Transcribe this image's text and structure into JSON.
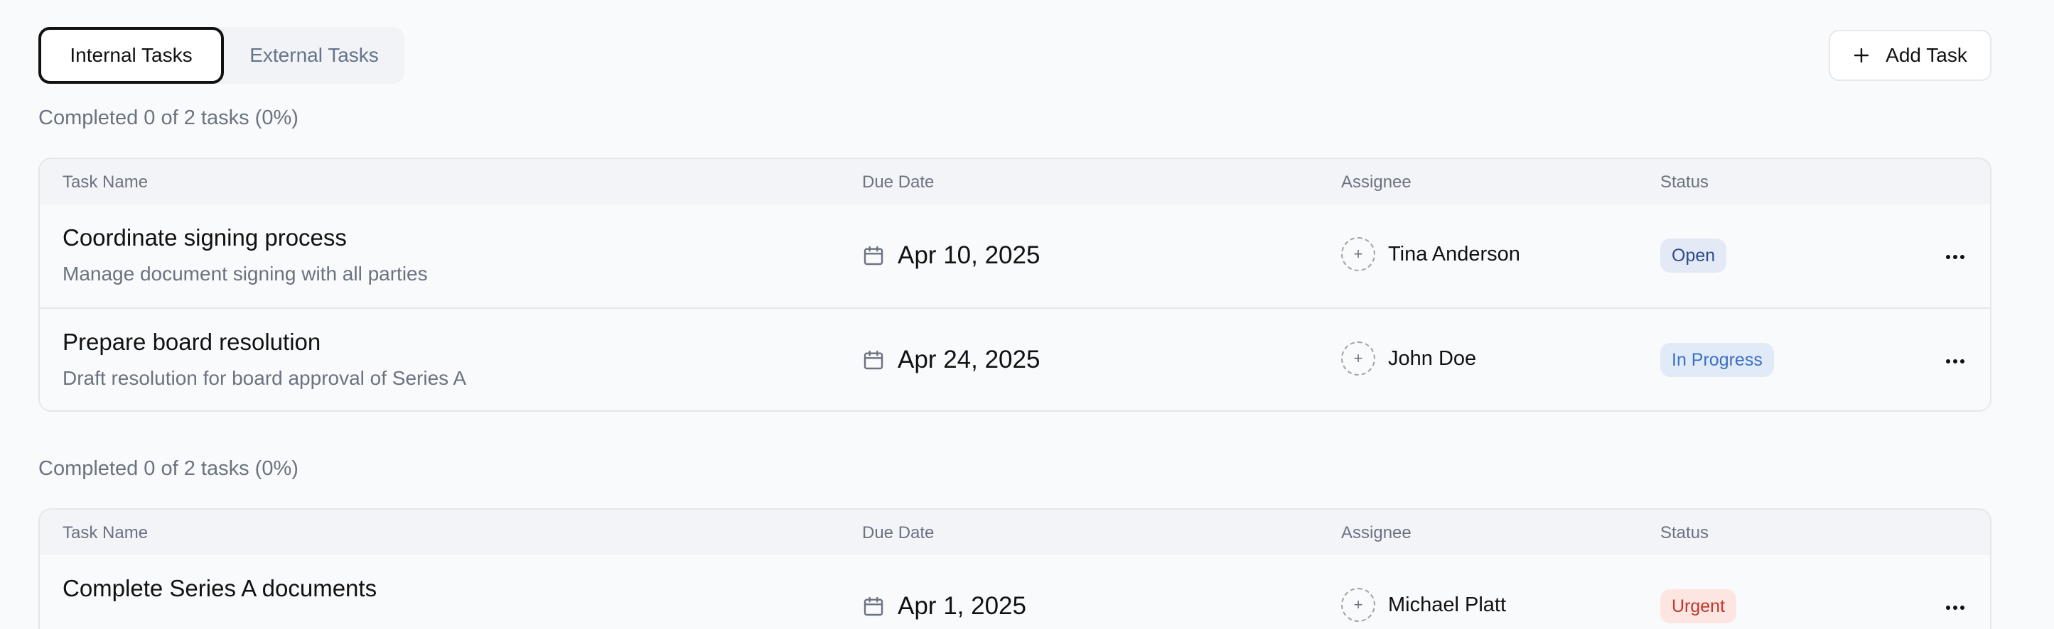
{
  "tabs": [
    {
      "label": "Internal Tasks",
      "active": true
    },
    {
      "label": "External Tasks",
      "active": false
    }
  ],
  "add_task_label": "Add Task",
  "columns": {
    "name": "Task Name",
    "due": "Due Date",
    "assignee": "Assignee",
    "status": "Status"
  },
  "sections": [
    {
      "summary": "Completed 0 of 2 tasks (0%)",
      "rows": [
        {
          "title": "Coordinate signing process",
          "desc": "Manage document signing with all parties",
          "due": "Apr 10, 2025",
          "assignee": "Tina Anderson",
          "status": "Open"
        },
        {
          "title": "Prepare board resolution",
          "desc": "Draft resolution for board approval of Series A",
          "due": "Apr 24, 2025",
          "assignee": "John Doe",
          "status": "In Progress"
        }
      ]
    },
    {
      "summary": "Completed 0 of 2 tasks (0%)",
      "rows": [
        {
          "title": "Complete Series A documents",
          "desc": "",
          "due": "Apr 1, 2025",
          "assignee": "Michael Platt",
          "status": "Urgent"
        }
      ]
    }
  ],
  "colors": {
    "open": "#2f4b8e",
    "in_progress": "#3b6fc4",
    "urgent": "#c0392b"
  },
  "icons": {
    "add": "plus-icon",
    "due": "calendar-icon",
    "assignee": "add-person-icon",
    "row_menu": "more-horizontal-icon"
  }
}
